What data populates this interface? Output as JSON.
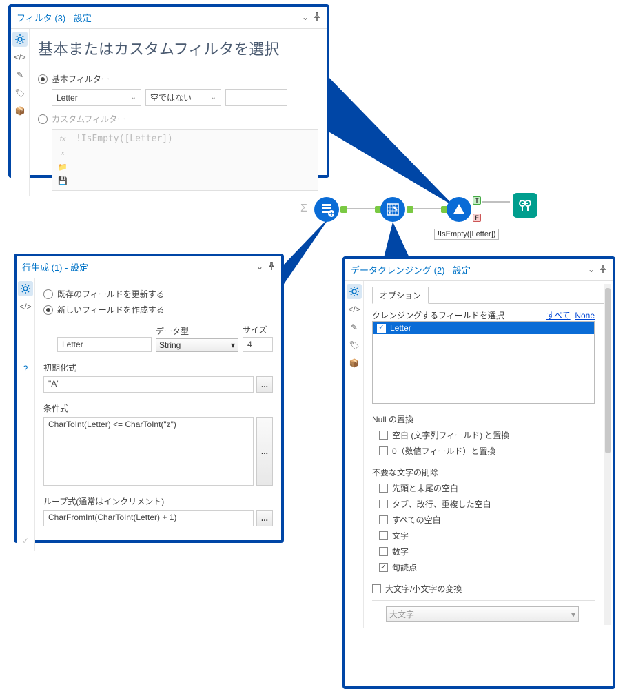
{
  "filter_panel": {
    "title": "フィルタ (3) - 設定",
    "heading": "基本またはカスタムフィルタを選択",
    "basic_label": "基本フィルター",
    "custom_label": "カスタムフィルター",
    "field_value": "Letter",
    "operator_value": "空ではない",
    "expression_placeholder": "!IsEmpty([Letter])"
  },
  "generate_panel": {
    "title": "行生成 (1) - 設定",
    "update_existing": "既存のフィールドを更新する",
    "create_new": "新しいフィールドを作成する",
    "data_type_label": "データ型",
    "size_label": "サイズ",
    "field_name": "Letter",
    "data_type_value": "String",
    "size_value": "4",
    "init_label": "初期化式",
    "init_value": "\"A\"",
    "cond_label": "条件式",
    "cond_value": "CharToInt(Letter) <= CharToInt(\"z\")",
    "loop_label": "ループ式(通常はインクリメント)",
    "loop_value": "CharFromInt(CharToInt(Letter) + 1)"
  },
  "cleanse_panel": {
    "title": "データクレンジング (2) - 設定",
    "tab": "オプション",
    "select_fields_label": "クレンジングするフィールドを選択",
    "all_link": "すべて",
    "none_link": "None",
    "field_item": "Letter",
    "null_section": "Null の置換",
    "null_blank": "空白 (文字列フィールド) と置換",
    "null_zero": "0（数値フィールド）と置換",
    "unwanted_section": "不要な文字の削除",
    "trim_whitespace": "先頭と末尾の空白",
    "tabs_dup": "タブ、改行、重複した空白",
    "all_whitespace": "すべての空白",
    "letters": "文字",
    "numbers": "数字",
    "punctuation": "句読点",
    "modify_case_label": "大文字/小文字の変換",
    "case_value": "大文字"
  },
  "canvas": {
    "filter_expr": "!IsEmpty([Letter])",
    "t": "T",
    "f": "F"
  },
  "chevron": "⌄",
  "pin": "📌",
  "dots": "..."
}
